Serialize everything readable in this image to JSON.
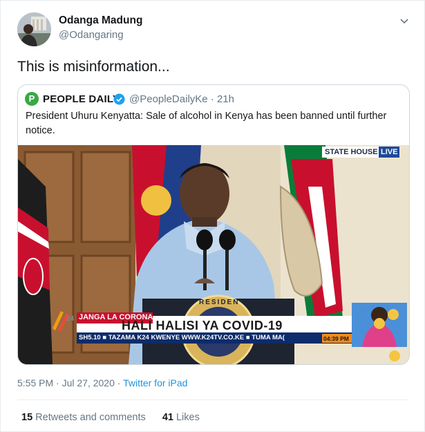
{
  "author": {
    "name": "Odanga Madung",
    "handle": "@Odangaring"
  },
  "tweet_text": "This is misinformation...",
  "quoted": {
    "logo_letter": "P",
    "name": "PEOPLE DAILY",
    "handle_time": "@PeopleDailyKe · 21h",
    "text": "President Uhuru Kenyatta: Sale of alcohol in Kenya has been banned until further notice."
  },
  "media": {
    "state_house": "STATE HOUSE",
    "live": "LIVE",
    "channel_number": "24",
    "red_label": "JANGA LA CORONA",
    "headline": "HALI HALISI YA COVID-19",
    "ticker": "SH5.10  ■ TAZAMA K24 KWENYE WWW.K24TV.CO.KE  ■ TUMA MA(",
    "clock": "04:39 PM",
    "seal_text": "RESIDEN"
  },
  "timestamp": "5:55 PM · Jul 27, 2020 · ",
  "source": "Twitter for iPad",
  "stats": {
    "retweets_count": "15",
    "retweets_label": "Retweets and comments",
    "likes_count": "41",
    "likes_label": "Likes"
  },
  "icons": {
    "menu": "chevron-down-icon",
    "verified": "verified-badge-icon"
  },
  "colors": {
    "link": "#1b95e0",
    "verified": "#1da1f2",
    "people_daily_green": "#3aa844",
    "ticker_red": "#c8102e"
  }
}
